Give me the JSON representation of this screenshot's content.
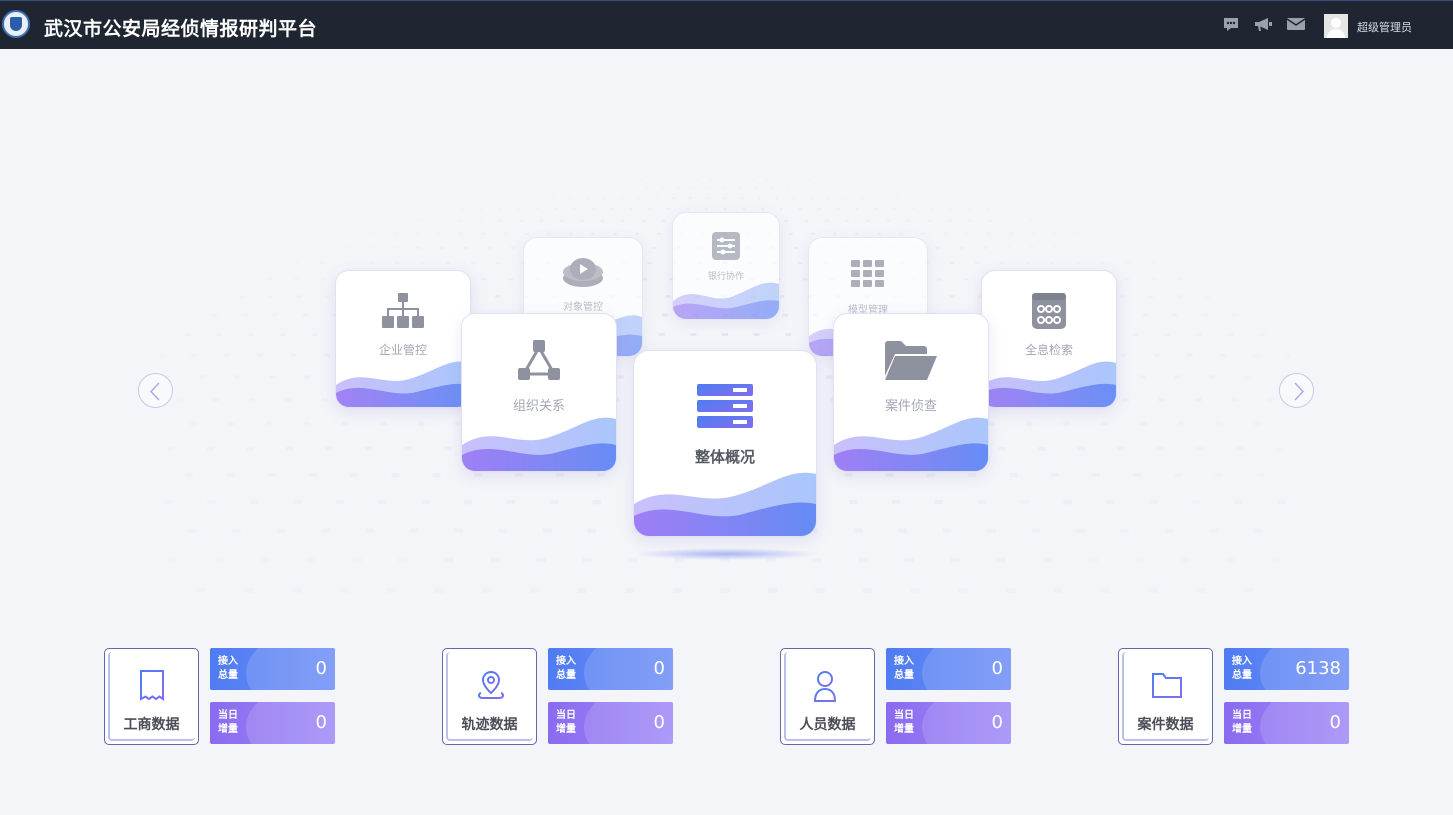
{
  "header": {
    "title": "武汉市公安局经侦情报研判平台",
    "icons": [
      "chat-icon",
      "megaphone-icon",
      "mail-icon"
    ],
    "user_name": "超级管理员"
  },
  "modules": {
    "center": "整体概况",
    "left_front": "组织关系",
    "right_front": "案件侦查",
    "left_mid": "企业管控",
    "right_mid": "全息检索",
    "left_back": "对象管控",
    "right_back": "模型管理",
    "top_back": "银行协作"
  },
  "stats": [
    {
      "name": "工商数据",
      "icon": "receipt-icon",
      "total_label": [
        "接入",
        "总量"
      ],
      "total": "0",
      "today_label": [
        "当日",
        "增量"
      ],
      "today": "0"
    },
    {
      "name": "轨迹数据",
      "icon": "location-pin-icon",
      "total_label": [
        "接入",
        "总量"
      ],
      "total": "0",
      "today_label": [
        "当日",
        "增量"
      ],
      "today": "0"
    },
    {
      "name": "人员数据",
      "icon": "person-list-icon",
      "total_label": [
        "接入",
        "总量"
      ],
      "total": "0",
      "today_label": [
        "当日",
        "增量"
      ],
      "today": "0"
    },
    {
      "name": "案件数据",
      "icon": "folder-icon",
      "total_label": [
        "接入",
        "总量"
      ],
      "total": "6138",
      "today_label": [
        "当日",
        "增量"
      ],
      "today": "0"
    }
  ],
  "colors": {
    "topbar": "#202631",
    "accent_blue": "#4f7cf2",
    "accent_purple": "#8a6bf0",
    "icon_gray": "#8b8f9c"
  }
}
